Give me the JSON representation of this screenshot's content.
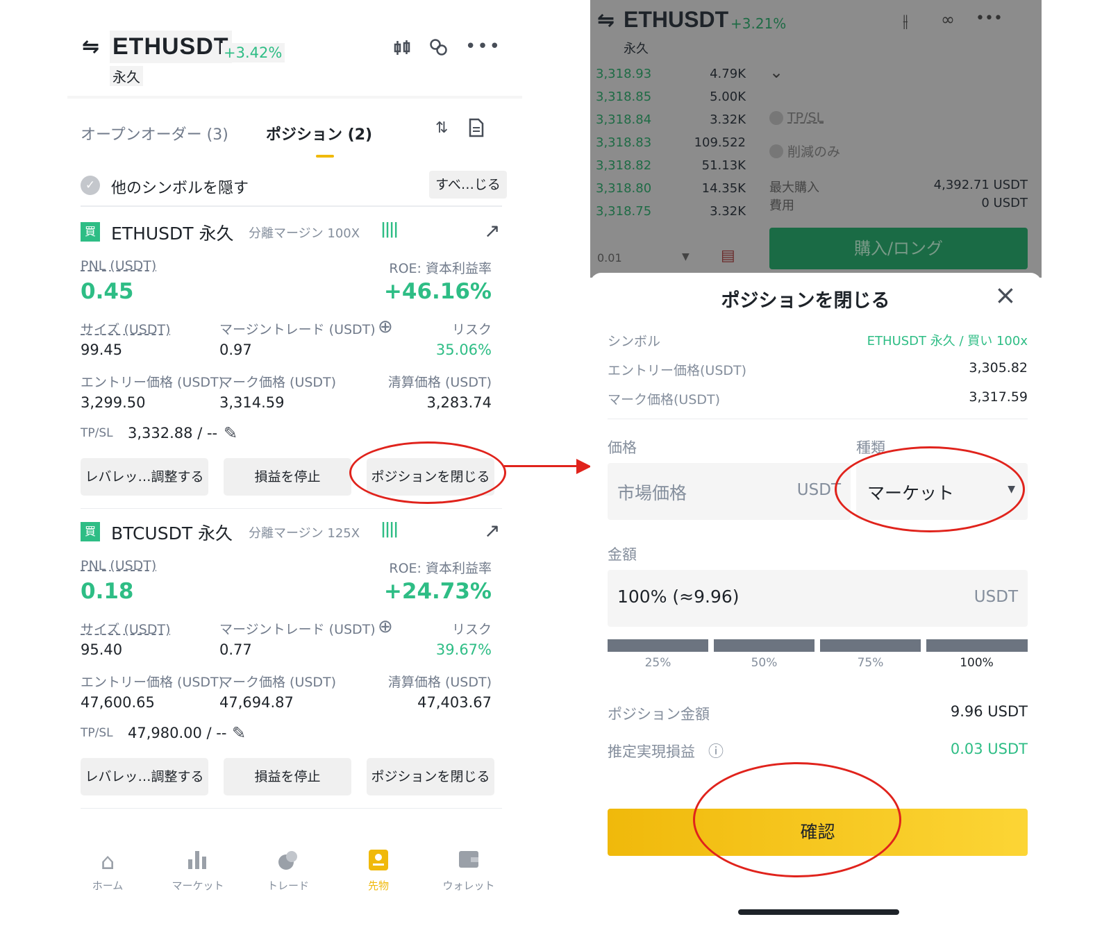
{
  "left": {
    "header": {
      "swap_icon": "⇋",
      "symbol": "ETHUSDT",
      "change": "+3.42%",
      "sub": "永久"
    },
    "tabs": {
      "open_orders": "オープンオーダー (3)",
      "positions": "ポジション (2)"
    },
    "hide_label": "他のシンボルを隠す",
    "close_all": "すべ…じる",
    "cards": [
      {
        "badge": "買",
        "symbol": "ETHUSDT 永久",
        "margin": "分離マージン 100X",
        "pnl_label": "PNL (USDT)",
        "roe_label": "ROE: 資本利益率",
        "pnl": "0.45",
        "roe": "+46.16%",
        "size_label": "サイズ (USDT)",
        "margin_ratio_label": "マージントレード (USDT)",
        "risk_label": "リスク",
        "size": "99.45",
        "margin_ratio": "0.97",
        "risk": "35.06%",
        "entry_label": "エントリー価格 (USDT)",
        "mark_label": "マーク価格 (USDT)",
        "liq_label": "清算価格 (USDT)",
        "entry": "3,299.50",
        "mark": "3,314.59",
        "liq": "3,283.74",
        "tpsl_label": "TP/SL",
        "tpsl": "3,332.88 / --",
        "btn_leverage": "レバレッ…調整する",
        "btn_stop": "損益を停止",
        "btn_close": "ポジションを閉じる"
      },
      {
        "badge": "買",
        "symbol": "BTCUSDT 永久",
        "margin": "分離マージン 125X",
        "pnl_label": "PNL (USDT)",
        "roe_label": "ROE: 資本利益率",
        "pnl": "0.18",
        "roe": "+24.73%",
        "size_label": "サイズ (USDT)",
        "margin_ratio_label": "マージントレード (USDT)",
        "risk_label": "リスク",
        "size": "95.40",
        "margin_ratio": "0.77",
        "risk": "39.67%",
        "entry_label": "エントリー価格 (USDT)",
        "mark_label": "マーク価格 (USDT)",
        "liq_label": "清算価格 (USDT)",
        "entry": "47,600.65",
        "mark": "47,694.87",
        "liq": "47,403.67",
        "tpsl_label": "TP/SL",
        "tpsl": "47,980.00 / --",
        "btn_leverage": "レバレッ…調整する",
        "btn_stop": "損益を停止",
        "btn_close": "ポジションを閉じる"
      }
    ],
    "nav": [
      "ホーム",
      "マーケット",
      "トレード",
      "先物",
      "ウォレット"
    ],
    "active_nav": "先物"
  },
  "right": {
    "header": {
      "symbol": "ETHUSDT",
      "change": "+3.21%",
      "sub": "永久"
    },
    "orderbook": [
      {
        "price": "3,318.93",
        "qty": "4.79K"
      },
      {
        "price": "3,318.85",
        "qty": "5.00K"
      },
      {
        "price": "3,318.84",
        "qty": "3.32K"
      },
      {
        "price": "3,318.83",
        "qty": "109.522"
      },
      {
        "price": "3,318.82",
        "qty": "51.13K"
      },
      {
        "price": "3,318.80",
        "qty": "14.35K"
      },
      {
        "price": "3,318.75",
        "qty": "3.32K"
      }
    ],
    "tpsl": "TP/SL",
    "reduce_only": "削減のみ",
    "max_buy_label": "最大購入",
    "cost_label": "費用",
    "max_buy": "4,392.71 USDT",
    "cost": "0 USDT",
    "long_btn": "購入/ロング",
    "precision": "0.01",
    "sheet": {
      "title": "ポジションを閉じる",
      "symbol_label": "シンボル",
      "symbol_val": "ETHUSDT 永久 / 買い 100x",
      "entry_label": "エントリー価格(USDT)",
      "entry_val": "3,305.82",
      "mark_label": "マーク価格(USDT)",
      "mark_val": "3,317.59",
      "price_label": "価格",
      "type_label": "種類",
      "price_placeholder": "市場価格",
      "price_unit": "USDT",
      "type_val": "マーケット",
      "amount_label": "金額",
      "amount_val": "100% (≈9.96)",
      "amount_unit": "USDT",
      "percents": [
        "25%",
        "50%",
        "75%",
        "100%"
      ],
      "pos_amount_label": "ポジション金額",
      "pos_amount": "9.96 USDT",
      "est_pnl_label": "推定実現損益",
      "est_pnl": "0.03 USDT",
      "confirm": "確認"
    }
  },
  "colors": {
    "green": "#2ebd85",
    "yellow": "#f0b90b",
    "annotation_red": "#e0231c"
  }
}
